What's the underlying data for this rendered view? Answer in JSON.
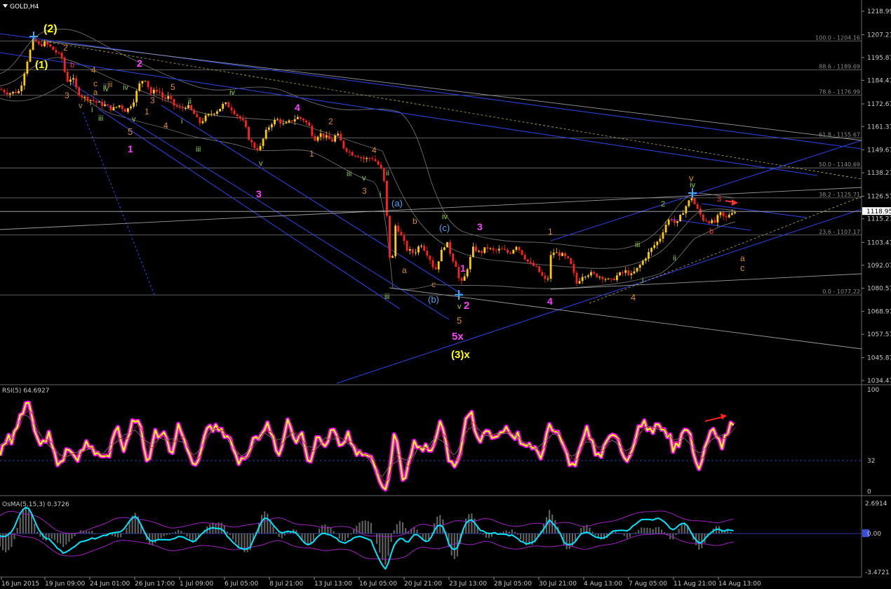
{
  "header": {
    "symbol": "GOLD,H4",
    "menu_icon": "triangle-down-icon"
  },
  "price_axis": [
    "1218.99",
    "1207.27",
    "1195.87",
    "1184.47",
    "1172.67",
    "1161.37",
    "1149.67",
    "1138.27",
    "1126.57",
    "1115.27",
    "1103.47",
    "1092.07",
    "1080.57",
    "1068.97",
    "1057.57",
    "1045.87",
    "1034.47"
  ],
  "current_price": "1118.95",
  "fib_levels": [
    "100.0 - 1204.16",
    "88.6 - 1189.69",
    "78.6 - 1176.99",
    "61.8 - 1155.67",
    "50.0 - 1140.69",
    "38.2 - 1125.71",
    "23.6 - 1107.17",
    "0.0 - 1077.22"
  ],
  "time_axis": [
    "16 Jun 2015",
    "19 Jun 09:00",
    "24 Jun 01:00",
    "26 Jun 17:00",
    "1 Jul 09:00",
    "6 Jul 05:00",
    "8 Jul 21:00",
    "13 Jul 13:00",
    "16 Jul 05:00",
    "20 Jul 21:00",
    "23 Jul 13:00",
    "28 Jul 05:00",
    "30 Jul 21:00",
    "4 Aug 13:00",
    "7 Aug 05:00",
    "11 Aug 21:00",
    "14 Aug 13:00"
  ],
  "rsi": {
    "title": "RSI(5) 64.6927",
    "axis": [
      "100",
      "32",
      "0"
    ]
  },
  "osma": {
    "title": "OsMA(5,15,3) 0.3726",
    "axis": [
      "2.6914",
      "0.00",
      "-3.4721"
    ]
  },
  "wave_labels": [
    "(2)",
    "(1)",
    "2",
    "3",
    "4",
    "5",
    "b",
    "a",
    "c",
    "iv",
    "v",
    "iii",
    "i",
    "ii",
    "1",
    "2",
    "3",
    "4",
    "5",
    "1",
    "iv",
    "iii",
    "v",
    "ii",
    "i",
    "4",
    "2",
    "1",
    "iii",
    "v",
    "iv",
    "3",
    "4",
    "ii",
    "i",
    "v",
    "iii",
    "3",
    "(a)",
    "b",
    "a",
    "c",
    "(c)",
    "iv",
    "3",
    "1",
    "(b)",
    "v",
    "iii",
    "5",
    "2",
    "5x",
    "(3)x",
    "4",
    "1",
    "4",
    "2",
    "ii",
    "iii",
    "i",
    "iv",
    "v",
    "3",
    "b",
    "a",
    "c",
    "4"
  ],
  "colors": {
    "background": "#000000",
    "bull_candle": "#ffcc00",
    "bear_candle": "#ff2020",
    "trendline": "#2a3fd8",
    "fib_line": "#8a8a8a",
    "bollinger": "#7a7a7a",
    "rsi_line": "#ffff00",
    "rsi_glow": "#ff00ff",
    "osma_main": "#00e5ff",
    "osma_signal": "#a020c0",
    "osma_hist": "#606060",
    "label_yellow": "#ffff00",
    "label_magenta": "#ff40ff",
    "label_orange": "#d98a2b",
    "label_green": "#8fcf3f",
    "label_blue": "#3fa9f5",
    "label_red": "#ff3030"
  },
  "chart_data": {
    "type": "candlestick",
    "title": "GOLD,H4",
    "ylim": [
      1034.47,
      1218.99
    ],
    "current": 1118.95,
    "path": [
      [
        0,
        1180
      ],
      [
        12,
        1178
      ],
      [
        28,
        1179
      ],
      [
        40,
        1196
      ],
      [
        48,
        1205
      ],
      [
        55,
        1202
      ],
      [
        65,
        1203
      ],
      [
        75,
        1200
      ],
      [
        88,
        1196
      ],
      [
        95,
        1184
      ],
      [
        103,
        1186
      ],
      [
        110,
        1179
      ],
      [
        118,
        1176
      ],
      [
        128,
        1175
      ],
      [
        140,
        1173
      ],
      [
        150,
        1172
      ],
      [
        160,
        1170
      ],
      [
        170,
        1172
      ],
      [
        180,
        1169
      ],
      [
        190,
        1174
      ],
      [
        198,
        1182
      ],
      [
        206,
        1186
      ],
      [
        215,
        1178
      ],
      [
        225,
        1180
      ],
      [
        233,
        1175
      ],
      [
        240,
        1176
      ],
      [
        248,
        1172
      ],
      [
        258,
        1170
      ],
      [
        266,
        1172
      ],
      [
        276,
        1168
      ],
      [
        284,
        1163
      ],
      [
        293,
        1166
      ],
      [
        302,
        1168
      ],
      [
        312,
        1170
      ],
      [
        320,
        1173
      ],
      [
        328,
        1171
      ],
      [
        338,
        1167
      ],
      [
        348,
        1163
      ],
      [
        356,
        1154
      ],
      [
        363,
        1151
      ],
      [
        370,
        1150
      ],
      [
        378,
        1158
      ],
      [
        386,
        1163
      ],
      [
        395,
        1165
      ],
      [
        405,
        1162
      ],
      [
        414,
        1164
      ],
      [
        423,
        1166
      ],
      [
        432,
        1165
      ],
      [
        440,
        1162
      ],
      [
        448,
        1155
      ],
      [
        455,
        1158
      ],
      [
        465,
        1156
      ],
      [
        473,
        1154
      ],
      [
        480,
        1158
      ],
      [
        490,
        1151
      ],
      [
        500,
        1148
      ],
      [
        510,
        1147
      ],
      [
        520,
        1145
      ],
      [
        530,
        1146
      ],
      [
        538,
        1143
      ],
      [
        546,
        1138
      ],
      [
        550,
        1125
      ],
      [
        554,
        1100
      ],
      [
        558,
        1090
      ],
      [
        564,
        1113
      ],
      [
        570,
        1108
      ],
      [
        580,
        1100
      ],
      [
        590,
        1098
      ],
      [
        600,
        1103
      ],
      [
        612,
        1096
      ],
      [
        620,
        1089
      ],
      [
        628,
        1098
      ],
      [
        636,
        1104
      ],
      [
        644,
        1096
      ],
      [
        650,
        1092
      ],
      [
        656,
        1082
      ],
      [
        662,
        1086
      ],
      [
        668,
        1093
      ],
      [
        675,
        1101
      ],
      [
        684,
        1098
      ],
      [
        694,
        1101
      ],
      [
        704,
        1099
      ],
      [
        714,
        1100
      ],
      [
        726,
        1098
      ],
      [
        736,
        1102
      ],
      [
        744,
        1098
      ],
      [
        754,
        1093
      ],
      [
        764,
        1091
      ],
      [
        772,
        1087
      ],
      [
        780,
        1083
      ],
      [
        786,
        1099
      ],
      [
        794,
        1098
      ],
      [
        802,
        1097
      ],
      [
        812,
        1094
      ],
      [
        822,
        1083
      ],
      [
        830,
        1087
      ],
      [
        840,
        1088
      ],
      [
        850,
        1087
      ],
      [
        860,
        1086
      ],
      [
        870,
        1084
      ],
      [
        880,
        1087
      ],
      [
        892,
        1089
      ],
      [
        900,
        1087
      ],
      [
        910,
        1091
      ],
      [
        920,
        1096
      ],
      [
        930,
        1101
      ],
      [
        940,
        1105
      ],
      [
        948,
        1112
      ],
      [
        956,
        1116
      ],
      [
        964,
        1112
      ],
      [
        972,
        1118
      ],
      [
        980,
        1123
      ],
      [
        986,
        1126
      ],
      [
        992,
        1121
      ],
      [
        1002,
        1115
      ],
      [
        1012,
        1114
      ],
      [
        1018,
        1113
      ],
      [
        1026,
        1118
      ],
      [
        1034,
        1115
      ],
      [
        1042,
        1119
      ],
      [
        1048,
        1119
      ]
    ],
    "fib_retracement": [
      {
        "level": "100.0",
        "value": 1204.16
      },
      {
        "level": "88.6",
        "value": 1189.69
      },
      {
        "level": "78.6",
        "value": 1176.99
      },
      {
        "level": "61.8",
        "value": 1155.67
      },
      {
        "level": "50.0",
        "value": 1140.69
      },
      {
        "level": "38.2",
        "value": 1125.71
      },
      {
        "level": "23.6",
        "value": 1107.17
      },
      {
        "level": "0.0",
        "value": 1077.22
      }
    ],
    "rsi": {
      "name": "RSI(5)",
      "last": 64.6927,
      "ylim": [
        0,
        100
      ],
      "level": 32
    },
    "osma": {
      "name": "OsMA(5,15,3)",
      "last": 0.3726,
      "ylim": [
        -3.4721,
        2.6914
      ]
    }
  }
}
